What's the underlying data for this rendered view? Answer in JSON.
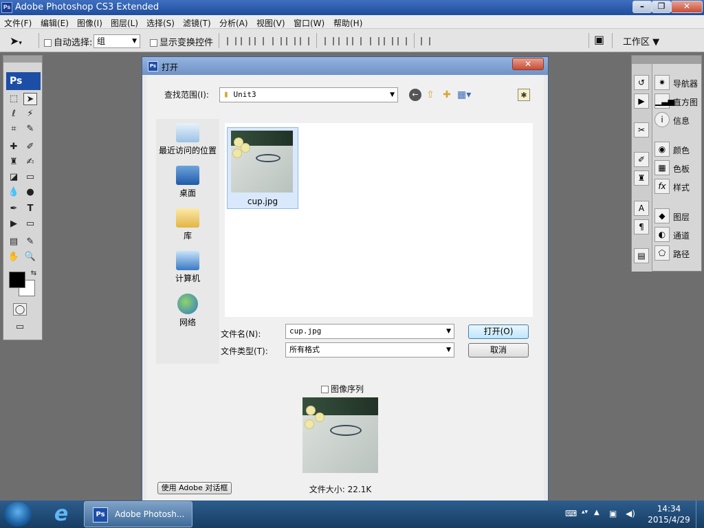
{
  "app": {
    "title": "Adobe Photoshop CS3 Extended",
    "icon_text": "Ps"
  },
  "menubar": [
    "文件(F)",
    "编辑(E)",
    "图像(I)",
    "图层(L)",
    "选择(S)",
    "滤镜(T)",
    "分析(A)",
    "视图(V)",
    "窗口(W)",
    "帮助(H)"
  ],
  "optionsbar": {
    "auto_select_label": "自动选择:",
    "auto_select_value": "组",
    "show_transform_label": "显示变换控件",
    "workspace_label": "工作区"
  },
  "toolbox": {
    "logo": "Ps"
  },
  "panels": [
    {
      "icon": "navigator-icon",
      "label": "导航器"
    },
    {
      "icon": "histogram-icon",
      "label": "直方图"
    },
    {
      "icon": "info-icon",
      "label": "信息"
    },
    {
      "icon": "color-icon",
      "label": "颜色"
    },
    {
      "icon": "swatches-icon",
      "label": "色板"
    },
    {
      "icon": "styles-icon",
      "label": "样式"
    },
    {
      "icon": "layers-icon",
      "label": "图层"
    },
    {
      "icon": "channels-icon",
      "label": "通道"
    },
    {
      "icon": "paths-icon",
      "label": "路径"
    }
  ],
  "dialog": {
    "title": "打开",
    "look_in_label": "查找范围(I):",
    "look_in_value": "Unit3",
    "places": [
      "最近访问的位置",
      "桌面",
      "库",
      "计算机",
      "网络"
    ],
    "file": {
      "name": "cup.jpg"
    },
    "filename_label": "文件名(N):",
    "filename_value": "cup.jpg",
    "filetype_label": "文件类型(T):",
    "filetype_value": "所有格式",
    "open_button": "打开(O)",
    "cancel_button": "取消",
    "image_sequence_label": "图像序列",
    "file_size": "文件大小: 22.1K",
    "adobe_dialog_button": "使用 Adobe 对话框"
  },
  "taskbar": {
    "task_label": "Adobe Photosh...",
    "time": "14:34",
    "date": "2015/4/29"
  },
  "colors": {
    "accent": "#1c4ea6",
    "selection": "#d9e8fb",
    "taskbar": "#1f4a75"
  }
}
